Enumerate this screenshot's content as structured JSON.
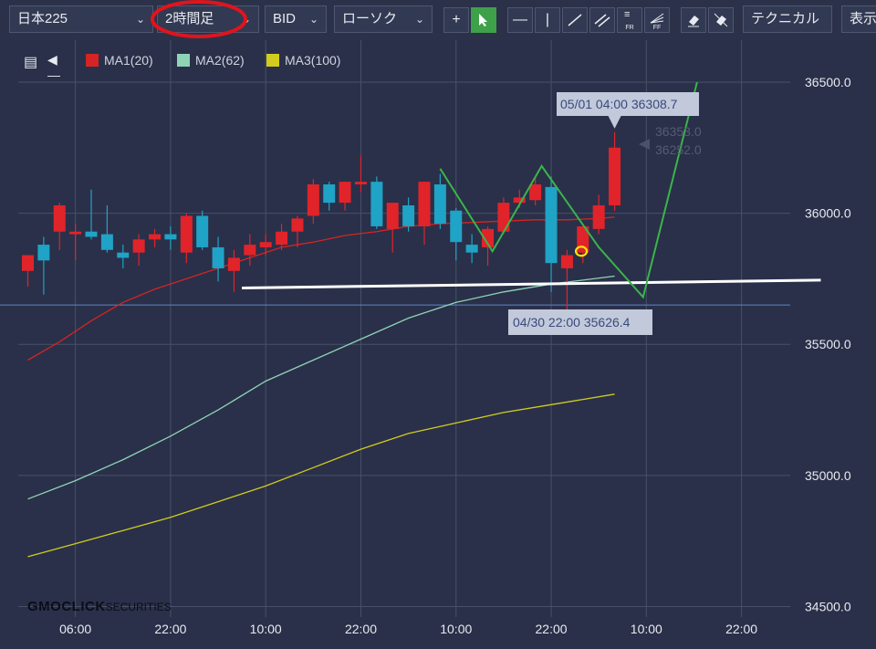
{
  "toolbar": {
    "symbol": "日本225",
    "timeframe": "2時間足",
    "price_type": "BID",
    "chart_style": "ローソク",
    "technical": "テクニカル",
    "display": "表示"
  },
  "icons": {
    "crosshair": "crosshair-icon",
    "pointer": "pointer-icon",
    "hline": "horizontal-line-icon",
    "vline": "vertical-line-icon",
    "trendline": "trendline-icon",
    "channel": "parallel-channel-icon",
    "fib_retracement": "fibonacci-retracement-icon",
    "fib_fan": "fibonacci-fan-icon",
    "eraser": "eraser-icon",
    "erase_all": "erase-all-icon",
    "fr_label": "FR",
    "ff_label": "FF"
  },
  "legend": [
    {
      "label": "MA1(20)",
      "color": "#d42424"
    },
    {
      "label": "MA2(62)",
      "color": "#8fd4b7"
    },
    {
      "label": "MA3(100)",
      "color": "#d1cc1e"
    }
  ],
  "chart_data": {
    "type": "candlestick",
    "ylim": [
      34460,
      36660
    ],
    "y_ticks": [
      34500.0,
      35000.0,
      35500.0,
      36000.0,
      36500.0
    ],
    "y_tick_labels": [
      "34500.0",
      "35000.0",
      "35500.0",
      "36000.0",
      "36500.0"
    ],
    "x_tick_labels": [
      {
        "index": 3,
        "label": "06:00"
      },
      {
        "index": 9,
        "label": "22:00"
      },
      {
        "index": 15,
        "label": "10:00"
      },
      {
        "index": 21,
        "label": "22:00"
      },
      {
        "index": 27,
        "label": "10:00"
      },
      {
        "index": 33,
        "label": "22:00"
      },
      {
        "index": 39,
        "label": "10:00"
      },
      {
        "index": 45,
        "label": "22:00"
      }
    ],
    "candles": [
      {
        "o": 35780,
        "h": 35840,
        "l": 35720,
        "c": 35840
      },
      {
        "o": 35880,
        "h": 35910,
        "l": 35690,
        "c": 35820
      },
      {
        "o": 35930,
        "h": 36040,
        "l": 35860,
        "c": 36030
      },
      {
        "o": 35920,
        "h": 35960,
        "l": 35820,
        "c": 35930
      },
      {
        "o": 35930,
        "h": 36090,
        "l": 35900,
        "c": 35910
      },
      {
        "o": 35920,
        "h": 36030,
        "l": 35850,
        "c": 35860
      },
      {
        "o": 35850,
        "h": 35880,
        "l": 35790,
        "c": 35830
      },
      {
        "o": 35850,
        "h": 35920,
        "l": 35800,
        "c": 35900
      },
      {
        "o": 35900,
        "h": 35940,
        "l": 35870,
        "c": 35920
      },
      {
        "o": 35920,
        "h": 35950,
        "l": 35860,
        "c": 35900
      },
      {
        "o": 35850,
        "h": 36000,
        "l": 35810,
        "c": 35990
      },
      {
        "o": 35990,
        "h": 36010,
        "l": 35860,
        "c": 35870
      },
      {
        "o": 35870,
        "h": 35910,
        "l": 35740,
        "c": 35790
      },
      {
        "o": 35780,
        "h": 35860,
        "l": 35700,
        "c": 35830
      },
      {
        "o": 35840,
        "h": 35920,
        "l": 35800,
        "c": 35880
      },
      {
        "o": 35870,
        "h": 35920,
        "l": 35840,
        "c": 35890
      },
      {
        "o": 35880,
        "h": 35960,
        "l": 35860,
        "c": 35930
      },
      {
        "o": 35930,
        "h": 35990,
        "l": 35870,
        "c": 35980
      },
      {
        "o": 35990,
        "h": 36130,
        "l": 35960,
        "c": 36110
      },
      {
        "o": 36110,
        "h": 36120,
        "l": 36010,
        "c": 36040
      },
      {
        "o": 36040,
        "h": 36120,
        "l": 36010,
        "c": 36120
      },
      {
        "o": 36110,
        "h": 36220,
        "l": 36080,
        "c": 36120
      },
      {
        "o": 36120,
        "h": 36140,
        "l": 35940,
        "c": 35950
      },
      {
        "o": 35940,
        "h": 36040,
        "l": 35850,
        "c": 36040
      },
      {
        "o": 36030,
        "h": 36060,
        "l": 35930,
        "c": 35950
      },
      {
        "o": 35950,
        "h": 36120,
        "l": 35880,
        "c": 36120
      },
      {
        "o": 36110,
        "h": 36150,
        "l": 35940,
        "c": 35960
      },
      {
        "o": 36010,
        "h": 36020,
        "l": 35820,
        "c": 35890
      },
      {
        "o": 35880,
        "h": 35920,
        "l": 35810,
        "c": 35850
      },
      {
        "o": 35870,
        "h": 35950,
        "l": 35800,
        "c": 35940
      },
      {
        "o": 35930,
        "h": 36060,
        "l": 35920,
        "c": 36040
      },
      {
        "o": 36040,
        "h": 36090,
        "l": 36020,
        "c": 36060
      },
      {
        "o": 36050,
        "h": 36140,
        "l": 36030,
        "c": 36110
      },
      {
        "o": 36100,
        "h": 36140,
        "l": 35700,
        "c": 35810
      },
      {
        "o": 35790,
        "h": 35860,
        "l": 35626.4,
        "c": 35840
      },
      {
        "o": 35850,
        "h": 35950,
        "l": 35810,
        "c": 35950
      },
      {
        "o": 35940,
        "h": 36070,
        "l": 35920,
        "c": 36030
      },
      {
        "o": 36030,
        "h": 36308.7,
        "l": 36010,
        "c": 36250
      }
    ],
    "ma_series": [
      {
        "name": "MA1(20)",
        "color": "#d42424",
        "points": [
          [
            0,
            35440
          ],
          [
            2,
            35510
          ],
          [
            4,
            35590
          ],
          [
            6,
            35660
          ],
          [
            8,
            35710
          ],
          [
            10,
            35750
          ],
          [
            12,
            35790
          ],
          [
            14,
            35830
          ],
          [
            16,
            35870
          ],
          [
            18,
            35890
          ],
          [
            20,
            35915
          ],
          [
            22,
            35930
          ],
          [
            24,
            35950
          ],
          [
            26,
            35960
          ],
          [
            28,
            35965
          ],
          [
            30,
            35970
          ],
          [
            32,
            35975
          ],
          [
            34,
            35975
          ],
          [
            36,
            35980
          ],
          [
            37,
            35985
          ]
        ]
      },
      {
        "name": "MA2(62)",
        "color": "#8fd4b7",
        "points": [
          [
            0,
            34910
          ],
          [
            3,
            34980
          ],
          [
            6,
            35060
          ],
          [
            9,
            35150
          ],
          [
            12,
            35250
          ],
          [
            15,
            35360
          ],
          [
            18,
            35440
          ],
          [
            21,
            35520
          ],
          [
            24,
            35600
          ],
          [
            27,
            35660
          ],
          [
            30,
            35700
          ],
          [
            33,
            35730
          ],
          [
            35,
            35745
          ],
          [
            37,
            35760
          ]
        ]
      },
      {
        "name": "MA3(100)",
        "color": "#d1cc1e",
        "points": [
          [
            0,
            34690
          ],
          [
            3,
            34740
          ],
          [
            6,
            34790
          ],
          [
            9,
            34840
          ],
          [
            12,
            34900
          ],
          [
            15,
            34960
          ],
          [
            18,
            35030
          ],
          [
            21,
            35100
          ],
          [
            24,
            35160
          ],
          [
            27,
            35200
          ],
          [
            30,
            35240
          ],
          [
            33,
            35270
          ],
          [
            35,
            35290
          ],
          [
            37,
            35310
          ]
        ]
      }
    ],
    "price_line": 35650,
    "current_price_labels": [
      "36353.0",
      "36252.0"
    ],
    "high_label": "05/01 04:00 36308.7",
    "low_label": "04/30 22:00 35626.4",
    "annotations": {
      "white_line": [
        [
          13.5,
          35715
        ],
        [
          50,
          35745
        ]
      ],
      "green_zigzag": [
        [
          26,
          36170
        ],
        [
          29.3,
          35855
        ],
        [
          32.4,
          36180
        ],
        [
          36,
          35870
        ],
        [
          38.8,
          35680
        ],
        [
          42.2,
          36500
        ]
      ],
      "yellow_circle": [
        34.9,
        35855
      ]
    }
  },
  "logo": {
    "brand": "GMOCLICK",
    "suffix": "SECURITIES"
  }
}
